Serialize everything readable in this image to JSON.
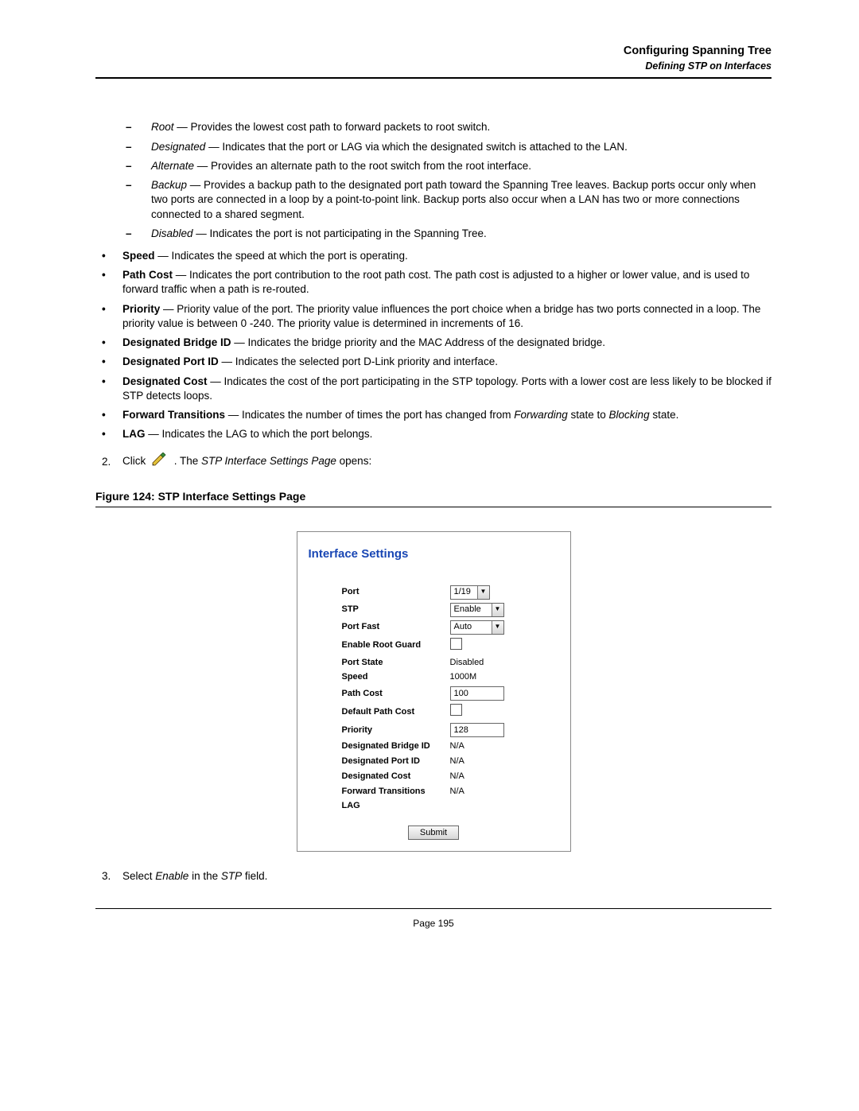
{
  "header": {
    "title": "Configuring Spanning Tree",
    "subtitle": "Defining STP on Interfaces"
  },
  "role_list": [
    {
      "term": "Root",
      "desc": " — Provides the lowest cost path to forward packets to root switch."
    },
    {
      "term": "Designated",
      "desc": " — Indicates that the port or LAG via which the designated switch is attached to the LAN."
    },
    {
      "term": "Alternate",
      "desc": " — Provides an alternate path to the root switch from the root interface."
    },
    {
      "term": "Backup",
      "desc": " — Provides a backup path to the designated port path toward the Spanning Tree leaves. Backup ports occur only when two ports are connected in a loop by a point-to-point link. Backup ports also occur when a LAN has two or more connections connected to a shared segment."
    },
    {
      "term": "Disabled",
      "desc": " — Indicates the port is not participating in the Spanning Tree."
    }
  ],
  "defs": [
    {
      "term": "Speed",
      "desc": " — Indicates the speed at which the port is operating."
    },
    {
      "term": "Path Cost",
      "desc": " — Indicates the port contribution to the root path cost. The path cost is adjusted to a higher or lower value, and is used to forward traffic when a path is re-routed."
    },
    {
      "term": "Priority",
      "desc": " — Priority value of the port. The priority value influences the port choice when a bridge has two ports connected in a loop. The priority value is between 0 -240. The priority value is determined in increments of 16."
    },
    {
      "term": "Designated Bridge ID",
      "desc": " — Indicates the bridge priority and the MAC Address of the designated bridge."
    },
    {
      "term": "Designated Port ID",
      "desc": " — Indicates the selected port D-Link priority and interface."
    },
    {
      "term": "Designated Cost",
      "desc": " — Indicates the cost of the port participating in the STP topology. Ports with a lower cost are less likely to be blocked if STP detects loops."
    },
    {
      "term": "Forward Transitions",
      "desc_pre": " — Indicates the number of times the port has changed from ",
      "i1": "Forwarding",
      "mid": " state to ",
      "i2": "Blocking",
      "desc_post": " state."
    },
    {
      "term": "LAG",
      "desc": " — Indicates the LAG to which the port belongs."
    }
  ],
  "step2": {
    "num": "2.",
    "pre": "Click ",
    "post1": " . The ",
    "page_name": "STP Interface Settings Page",
    "post2": " opens:"
  },
  "figure": {
    "caption": "Figure 124: STP Interface Settings Page"
  },
  "panel": {
    "title": "Interface Settings",
    "rows": {
      "port_label": "Port",
      "port_value": "1/19",
      "stp_label": "STP",
      "stp_value": "Enable",
      "pf_label": "Port Fast",
      "pf_value": "Auto",
      "erg_label": "Enable Root Guard",
      "ps_label": "Port State",
      "ps_value": "Disabled",
      "spd_label": "Speed",
      "spd_value": "1000M",
      "pc_label": "Path Cost",
      "pc_value": "100",
      "dpc_label": "Default Path Cost",
      "prio_label": "Priority",
      "prio_value": "128",
      "dbid_label": "Designated Bridge ID",
      "dbid_value": "N/A",
      "dpid_label": "Designated Port ID",
      "dpid_value": "N/A",
      "dcost_label": "Designated Cost",
      "dcost_value": "N/A",
      "ft_label": "Forward Transitions",
      "ft_value": "N/A",
      "lag_label": "LAG",
      "lag_value": ""
    },
    "submit": "Submit"
  },
  "step3": {
    "num": "3.",
    "pre": "Select ",
    "w1": "Enable",
    "mid": " in the ",
    "w2": "STP",
    "post": " field."
  },
  "footer": {
    "page": "Page 195"
  }
}
